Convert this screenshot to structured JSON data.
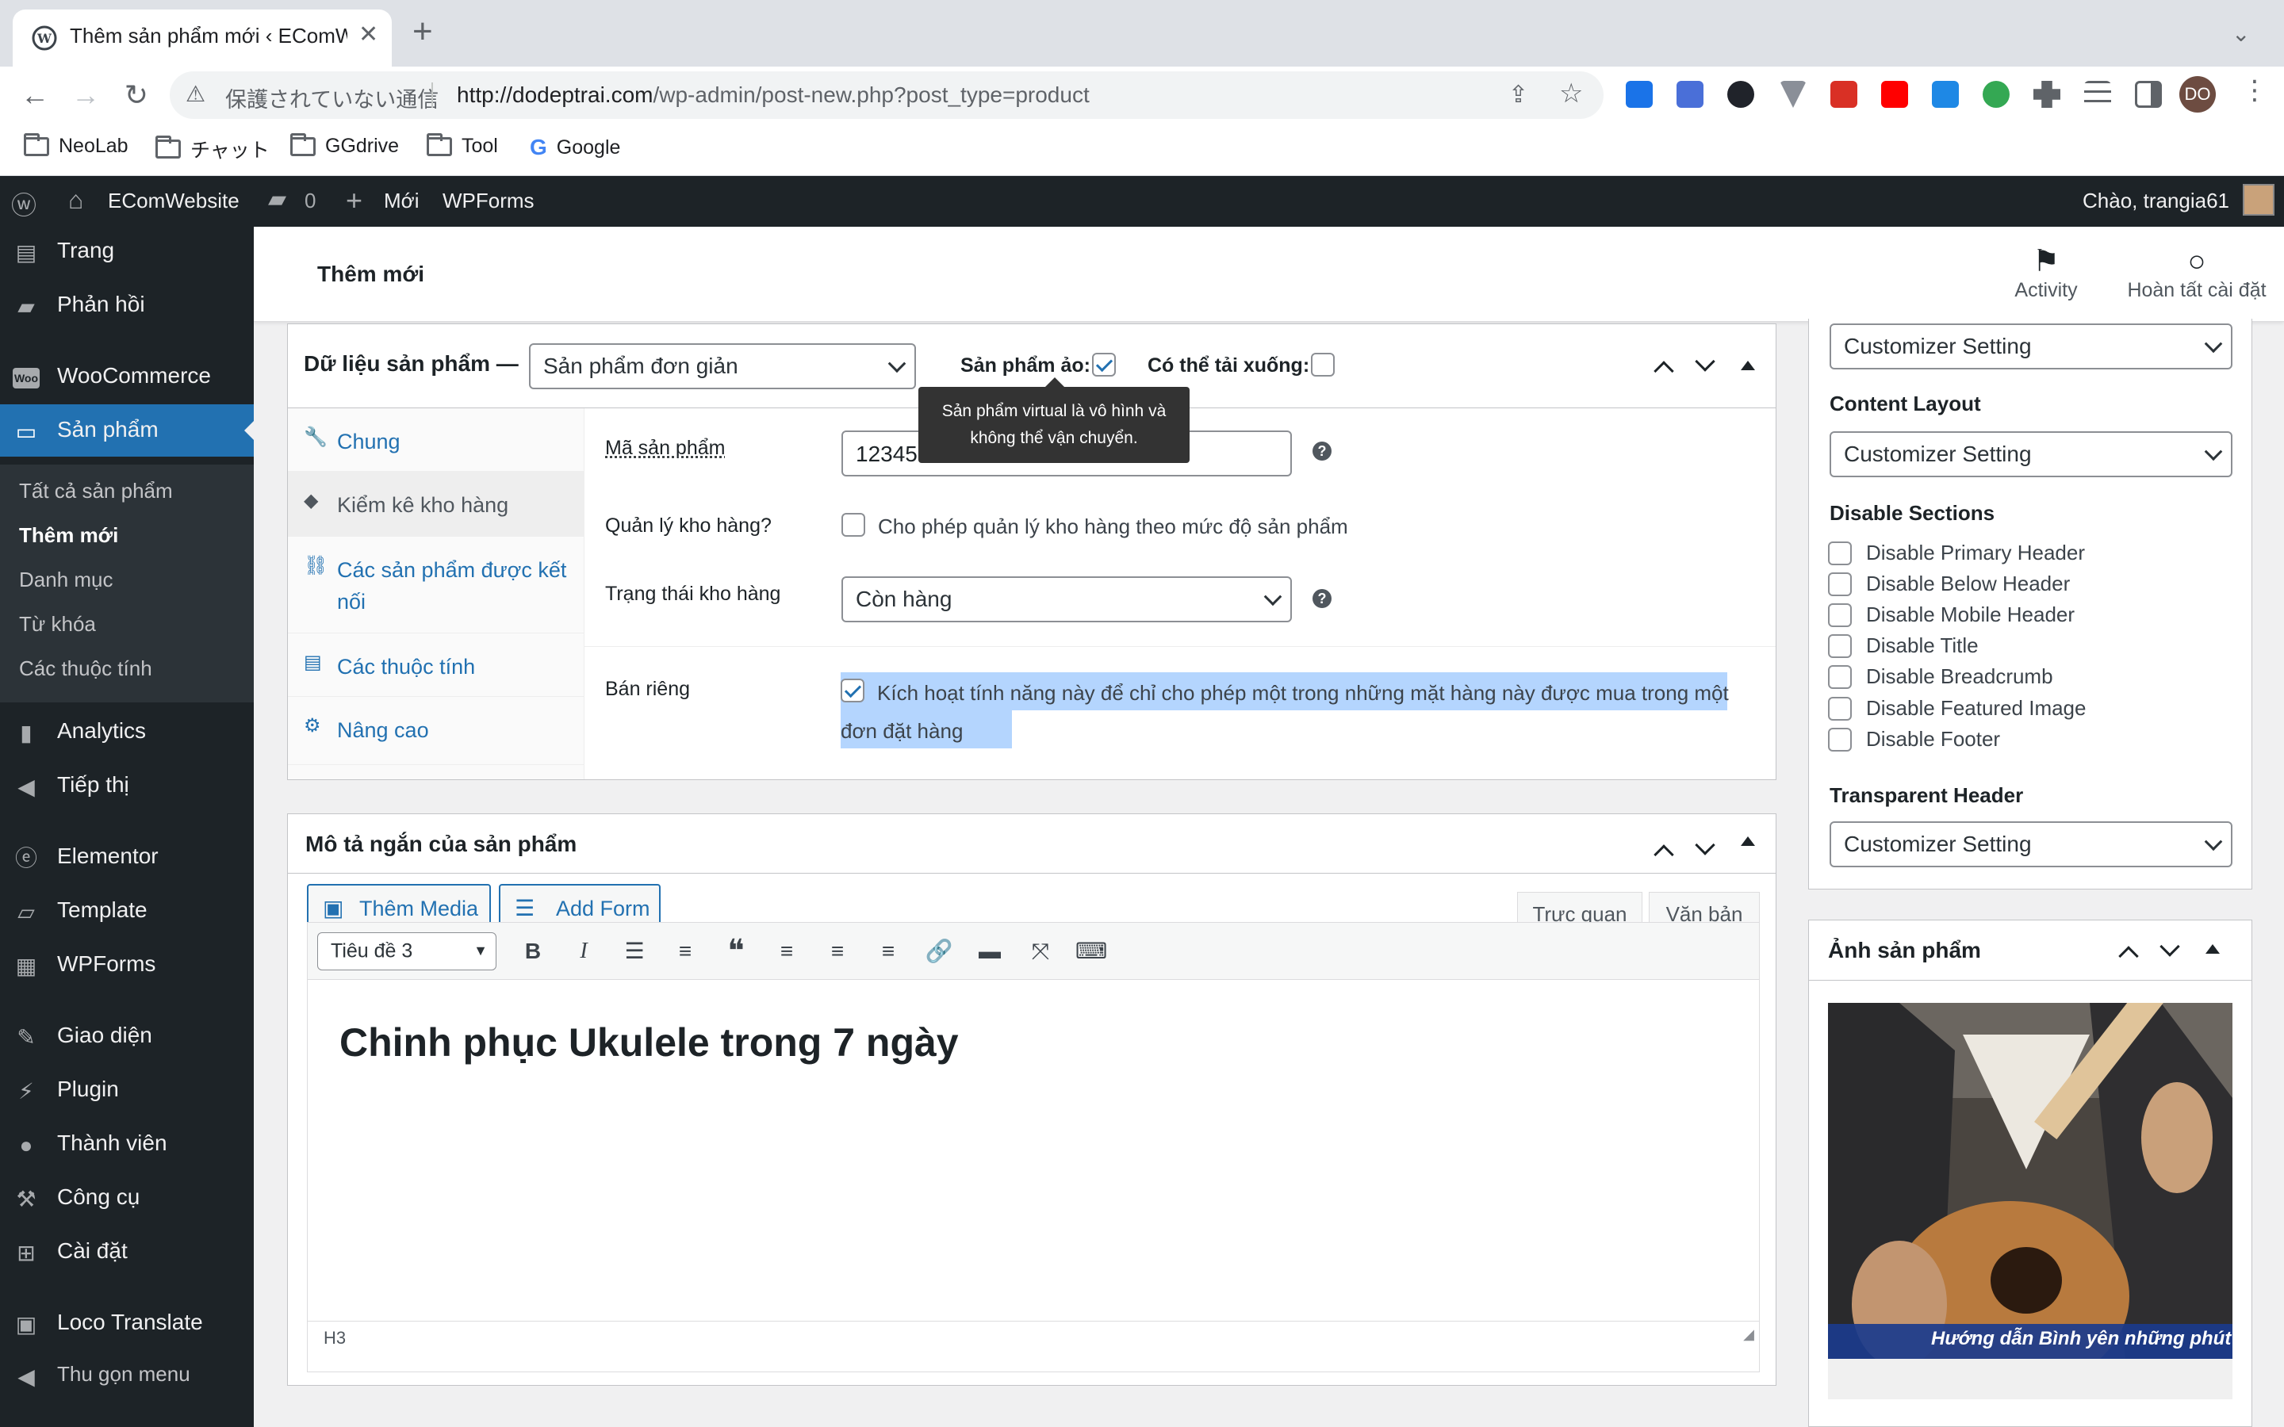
{
  "browser": {
    "tab_title": "Thêm sản phẩm mới ‹ EComWebsite",
    "security_label": "保護されていない通信",
    "url_host": "http://dodeptrai.com",
    "url_path": "/wp-admin/post-new.php?post_type=product",
    "profile_initials": "DO",
    "bookmarks": [
      "NeoLab",
      "チャット",
      "GGdrive",
      "Tool",
      "Google"
    ]
  },
  "adminbar": {
    "site_name": "EComWebsite",
    "comments_count": "0",
    "new_label": "Mới",
    "wpforms_label": "WPForms",
    "howdy": "Chào, trangia61"
  },
  "sidebar": {
    "items": [
      "Trang",
      "Phản hồi",
      "WooCommerce",
      "Sản phẩm",
      "Analytics",
      "Tiếp thị",
      "Elementor",
      "Template",
      "WPForms",
      "Giao diện",
      "Plugin",
      "Thành viên",
      "Công cụ",
      "Cài đặt",
      "Loco Translate",
      "Thu gọn menu"
    ],
    "submenu": [
      "Tất cả sản phẩm",
      "Thêm mới",
      "Danh mục",
      "Từ khóa",
      "Các thuộc tính"
    ]
  },
  "header": {
    "title": "Thêm mới",
    "activity": "Activity",
    "finish_setup": "Hoàn tất cài đặt"
  },
  "product_data": {
    "heading": "Dữ liệu sản phẩm —",
    "type_value": "Sản phẩm đơn giản",
    "virtual_label": "Sản phẩm ảo:",
    "downloadable_label": "Có thể tải xuống:",
    "tooltip": "Sản phẩm virtual là vô hình và không thể vận chuyển.",
    "tabs": [
      "Chung",
      "Kiểm kê kho hàng",
      "Các sản phẩm được kết nối",
      "Các thuộc tính",
      "Nâng cao"
    ],
    "sku_label": "Mã sản phẩm",
    "sku_value": "12345",
    "manage_stock_label": "Quản lý kho hàng?",
    "manage_stock_text": "Cho phép quản lý kho hàng theo mức độ sản phẩm",
    "stock_status_label": "Trạng thái kho hàng",
    "stock_status_value": "Còn hàng",
    "sold_individually_label": "Bán riêng",
    "sold_individually_text": "Kích hoạt tính năng này để chỉ cho phép một trong những mặt hàng này được mua trong một đơn đặt hàng"
  },
  "short_description": {
    "heading": "Mô tả ngắn của sản phẩm",
    "add_media": "Thêm Media",
    "add_form": "Add Form",
    "tab_visual": "Trực quan",
    "tab_text": "Văn bản",
    "format_value": "Tiêu đề 3",
    "content": "Chinh phục Ukulele trong 7 ngày",
    "path": "H3"
  },
  "layout_settings": {
    "top_select": "Customizer Setting",
    "content_layout_label": "Content Layout",
    "content_layout_value": "Customizer Setting",
    "disable_sections_label": "Disable Sections",
    "disable_options": [
      "Disable Primary Header",
      "Disable Below Header",
      "Disable Mobile Header",
      "Disable Title",
      "Disable Breadcrumb",
      "Disable Featured Image",
      "Disable Footer"
    ],
    "transparent_header_label": "Transparent Header",
    "transparent_header_value": "Customizer Setting"
  },
  "product_image": {
    "heading": "Ảnh sản phẩm",
    "caption": "Hướng dẫn Bình yên những phút giây"
  }
}
